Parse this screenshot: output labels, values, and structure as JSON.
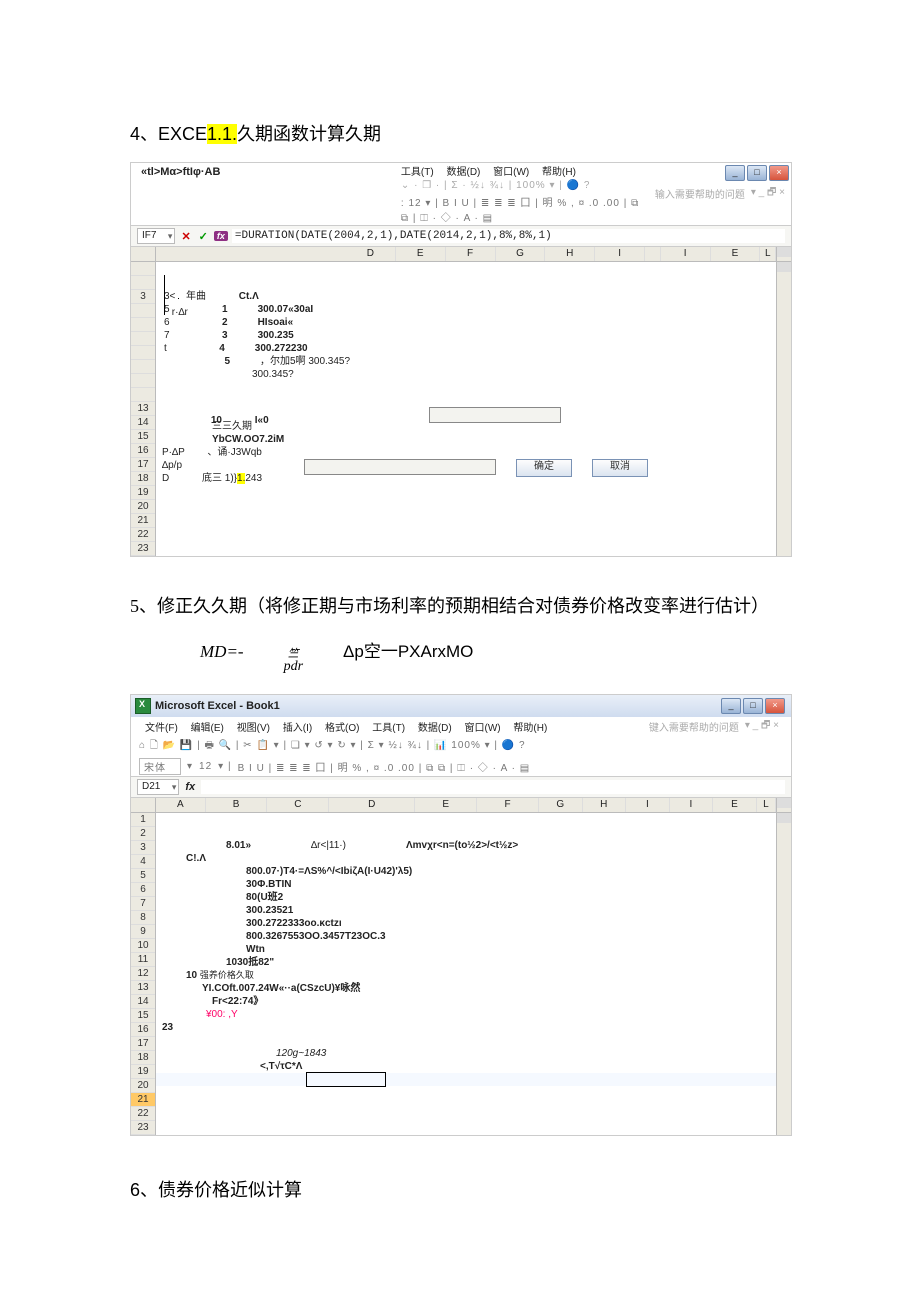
{
  "heading4": {
    "prefix": "4、EXCE",
    "hl": "1.1.",
    "suffix": "久期函数计算久期"
  },
  "shot1": {
    "title": "«tl>Mα>ftIφ·AB",
    "menu": [
      "工具(T)",
      "数据(D)",
      "窗口(W)",
      "帮助(H)"
    ],
    "help_placeholder": "输入需要帮助的问题",
    "toolbar_icons": "⌄ · ❒ · | Σ · ½↓ ¾↓ | 100% ▾ | 🔵 ?",
    "format_bar": ": 12 ▾ | B  I  U | ≣ ≣ ≣ 囗 | 明 % , ¤ .0 .00 | ⧉ ⧉ | ◫ · ◇ · A · ▤",
    "name_box": "IF7",
    "formula": "=DURATION(DATE(2004,2,1),DATE(2014,2,1),8%,8%,1)",
    "cols": [
      "D",
      "E",
      "F",
      "G",
      "H",
      "I",
      "",
      "I",
      "E",
      "L"
    ],
    "rows_left_labels": {
      "r2": "r·∆r",
      "r3": "年曲",
      "p_label": "P·∆P",
      "dp_label": "∆p/p",
      "d_label": "D"
    },
    "col_ct": "Ct.Λ",
    "data_rows": [
      {
        "n": "3<",
        "y": "",
        "idx": "1",
        "val": "300.07«30aI"
      },
      {
        "n": "5",
        "y": "",
        "idx": "2",
        "val": "HIsoai«"
      },
      {
        "n": "6",
        "y": "",
        "idx": "3",
        "val": "300.235"
      },
      {
        "n": "7",
        "y": "",
        "idx": "4",
        "val": "300.272230"
      },
      {
        "n": "t",
        "y": "",
        "idx": "5",
        "val": "，尔加5啊\n300.345?"
      }
    ],
    "mid_rows": {
      "r13_idx": "10",
      "r13_val": "I«0",
      "r14": "三三久期",
      "r15": "YbCW.OO7.2iM",
      "r16": "、诵·J3Wqb"
    },
    "row19": {
      "prefix": "底三 1)}",
      "hl": "1.",
      "suffix": "243"
    },
    "btn_ok": "确定",
    "btn_cancel": "取消",
    "row_nums": [
      "",
      "",
      "3",
      "",
      "",
      "",
      "",
      "",
      "",
      "",
      "13",
      "14",
      "15",
      "16",
      "17",
      "18",
      "19",
      "20",
      "21",
      "22",
      "23"
    ]
  },
  "para5": "5、修正久久期（将修正期与市场利率的预期相结合对债券价格改变率进行估计）",
  "formula_line": {
    "left": "MD=-",
    "mid_num": "竺",
    "mid_den": "pdr",
    "right": "Δp空一PXArxMO"
  },
  "shot2": {
    "title": "Microsoft Excel - Book1",
    "menu": [
      "文件(F)",
      "编辑(E)",
      "视图(V)",
      "插入(I)",
      "格式(O)",
      "工具(T)",
      "数据(D)",
      "窗口(W)",
      "帮助(H)"
    ],
    "help_placeholder": "键入需要帮助的问题",
    "std_toolbar": "⌂ 🗋 📂 💾 | 🖶 🔍 | ✂ 📋 ▾ | ❏ ▾ ↺ ▾ ↻ ▾ | Σ ▾ ½↓ ¾↓ | 📊 100%  ▾ | 🔵 ?",
    "font": "宋体",
    "font_size": "12",
    "format_bar": "B  I  U | ≣ ≣ ≣ 囗 | 明 % , ¤ .0 .00 | ⧉ ⧉ | ◫ · ◇ · A · ▤",
    "name_box": "D21",
    "fx": "fx",
    "cols": [
      "A",
      "B",
      "C",
      "D",
      "E",
      "F",
      "G",
      "H",
      "I",
      "I",
      "E",
      "L"
    ],
    "row_nums": [
      "1",
      "2",
      "3",
      "4",
      "5",
      "6",
      "7",
      "8",
      "9",
      "10",
      "11",
      "12",
      "13",
      "14",
      "15",
      "16",
      "17",
      "18",
      "19",
      "20",
      "21",
      "22",
      "23"
    ],
    "r3_b": "8.01»",
    "r3_d": "∆r<|11·)",
    "r3_e": "Λmvχr<n=(to½2>/<t½z>",
    "r4_a": "C!.Λ",
    "r5": "800.07·)T4·=ΛS%^/<IbiζA(I·U42)'λ5)",
    "r6": "30Φ.BTIN",
    "r7": "80(U班2",
    "r8": "300.23521",
    "r9": "300.2722333oo.κctzı",
    "r10": "800.3267553OO.3457T23OC.3",
    "r11": "Wtn",
    "r12": "1030抵82\"",
    "r13_idx": "10",
    "r13_txt": "强养价格久取",
    "r14": "YI.COft.007.24W«··a(CSzcU)¥咏然",
    "r15": "Fr<22:74》",
    "r16": "¥00: ,Y",
    "r17": "23",
    "r19": "120g~1843",
    "r20": "<,T√τC*Λ",
    "sel_row": "21"
  },
  "heading6": "6、债券价格近似计算"
}
